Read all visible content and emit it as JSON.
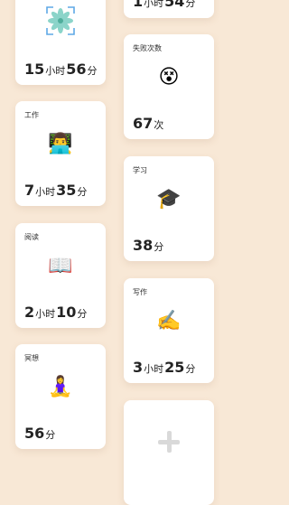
{
  "cards": {
    "focus": {
      "icon": "lotus-icon",
      "h": "15",
      "h_unit": "小时",
      "m": "56",
      "m_unit": "分"
    },
    "top_right": {
      "h": "1",
      "h_unit": "小时",
      "m": "54",
      "m_unit": "分"
    },
    "fail": {
      "label": "失败次数",
      "icon": "dizzy-face-icon",
      "count": "67",
      "count_unit": "次"
    },
    "work": {
      "label": "工作",
      "icon": "technologist-icon",
      "h": "7",
      "h_unit": "小时",
      "m": "35",
      "m_unit": "分"
    },
    "study": {
      "label": "学习",
      "icon": "graduation-cap-icon",
      "m": "38",
      "m_unit": "分"
    },
    "read": {
      "label": "阅读",
      "icon": "open-book-icon",
      "h": "2",
      "h_unit": "小时",
      "m": "10",
      "m_unit": "分"
    },
    "write": {
      "label": "写作",
      "icon": "writing-hand-icon",
      "h": "3",
      "h_unit": "小时",
      "m": "25",
      "m_unit": "分"
    },
    "meditate": {
      "label": "冥想",
      "icon": "person-lotus-position-icon",
      "m": "56",
      "m_unit": "分"
    }
  },
  "add_card": {
    "icon": "plus-icon"
  }
}
